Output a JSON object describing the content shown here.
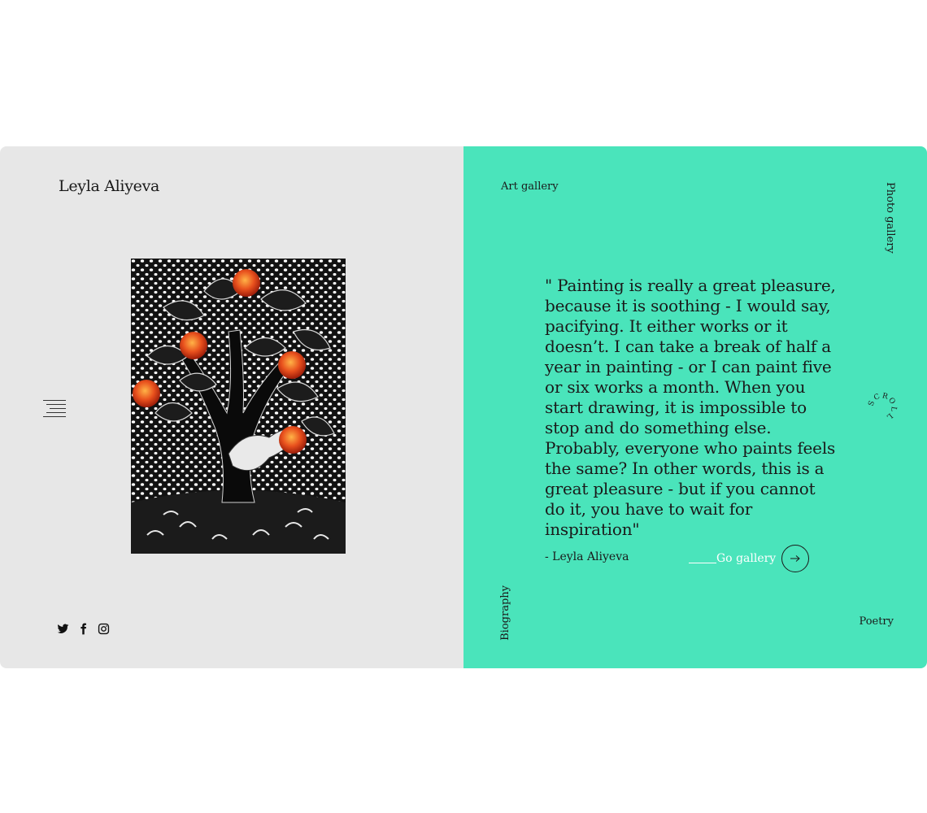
{
  "colors": {
    "left_bg": "#e7e7e7",
    "accent": "#4ae4bb",
    "text": "#1a1a1a",
    "link": "#ffffff"
  },
  "left": {
    "brand": "Leyla Aliyeva",
    "menu_icon": "hamburger-menu-icon",
    "artwork_alt": "Painting of a tree with red fruits and a bird on a dotted black background",
    "socials": [
      {
        "name": "twitter",
        "icon": "twitter-icon"
      },
      {
        "name": "facebook",
        "icon": "facebook-icon"
      },
      {
        "name": "instagram",
        "icon": "instagram-icon"
      }
    ]
  },
  "right": {
    "nav": {
      "art_gallery": "Art gallery",
      "photo_gallery": "Photo gallery",
      "biography": "Biography",
      "poetry": "Poetry"
    },
    "quote": "\" Painting is really a great pleasure, because it is soothing - I would say, pacifying.  It either works or it doesn’t. I can take a break of half a year in painting - or I can paint five or six works a month. When you start drawing, it is impossible to stop and do something else. Probably, everyone who paints feels the same?  In other words, this is a great pleasure - but if you cannot do it, you have to wait for inspiration\"",
    "author": "- Leyla Aliyeva",
    "go_gallery": "Go gallery",
    "scroll_text": "SCROLL",
    "arrow_icon": "arrow-right-icon"
  }
}
